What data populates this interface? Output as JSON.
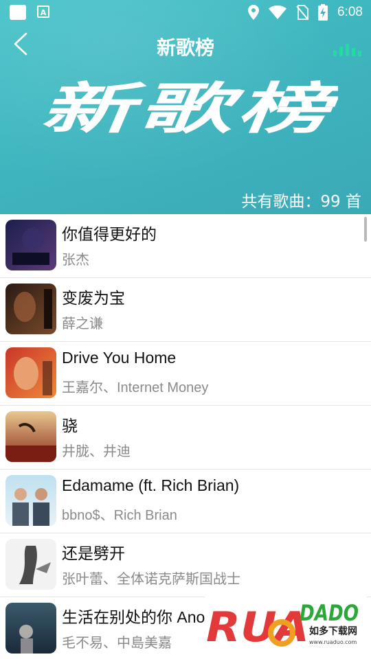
{
  "status_bar": {
    "time": "6:08",
    "app_icon_letter": "A"
  },
  "nav": {
    "title": "新歌榜",
    "back_icon": "chevron-left-icon",
    "playing_icon": "equalizer-icon"
  },
  "banner": {
    "text": "新歌榜"
  },
  "summary": {
    "song_count": "共有歌曲：99 首"
  },
  "songs": [
    {
      "title": "你值得更好的",
      "artist": "张杰",
      "cover_colors": [
        "#1b1f4a",
        "#5b3a7a"
      ]
    },
    {
      "title": "变废为宝",
      "artist": "薛之谦",
      "cover_colors": [
        "#2a1a14",
        "#7a4a2a"
      ]
    },
    {
      "title": "Drive You Home",
      "artist": "王嘉尔、Internet Money",
      "cover_colors": [
        "#c8362a",
        "#f08a3a"
      ]
    },
    {
      "title": "骁",
      "artist": "井胧、井迪",
      "cover_colors": [
        "#c89a5a",
        "#8a2a1a"
      ]
    },
    {
      "title": "Edamame (ft. Rich Brian)",
      "artist": "bbno$、Rich Brian",
      "cover_colors": [
        "#bfe0f0",
        "#5a6a7a"
      ]
    },
    {
      "title": "还是劈开",
      "artist": "张叶蕾、全体诺克萨斯国战士",
      "cover_colors": [
        "#f2f2f2",
        "#5a5a5a"
      ]
    },
    {
      "title": "生活在别处的你 Ano",
      "artist": "毛不易、中島美嘉",
      "cover_colors": [
        "#3a5a6a",
        "#1a2a3a"
      ]
    }
  ],
  "watermark": {
    "brand": "RUANDADO",
    "tagline": "如多下载网",
    "url": "www.ruaduo.com"
  }
}
